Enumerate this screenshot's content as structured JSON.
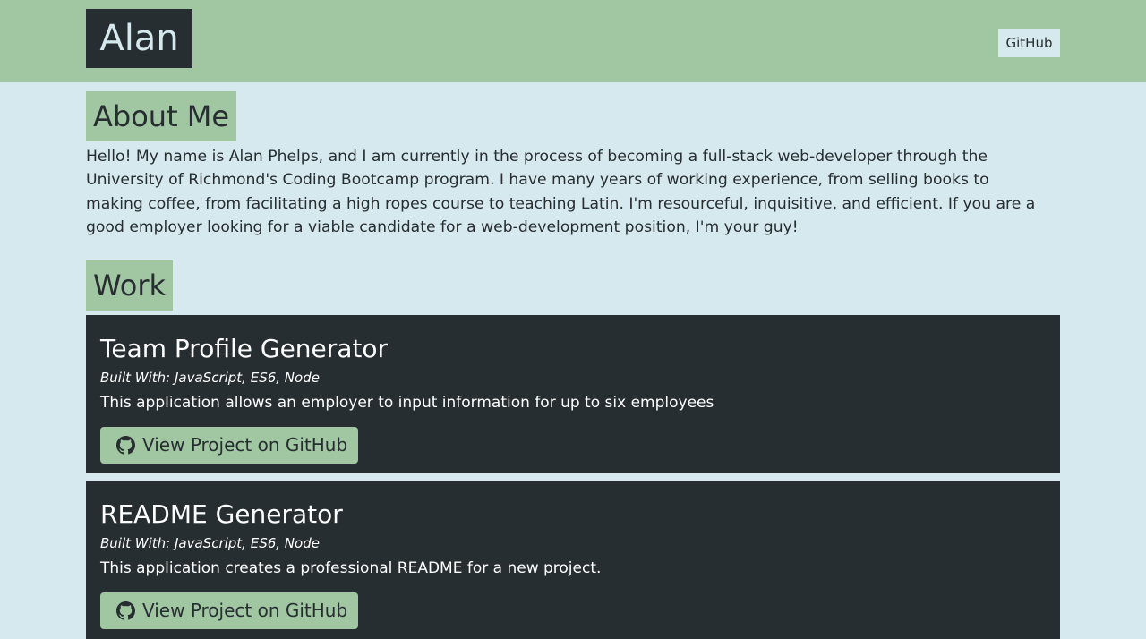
{
  "header": {
    "brand": "Alan",
    "nav_link": "GitHub"
  },
  "about": {
    "heading": "About Me",
    "text": "Hello! My name is Alan Phelps, and I am currently in the process of becoming a full-stack web-developer through the University of Richmond's Coding Bootcamp program. I have many years of working experience, from selling books to making coffee, from facilitating a high ropes course to teaching Latin. I'm resourceful, inquisitive, and efficient. If you are a good employer looking for a viable candidate for a web-development position, I'm your guy!"
  },
  "work": {
    "heading": "Work",
    "projects": [
      {
        "title": "Team Profile Generator",
        "built_with": "Built With: JavaScript, ES6, Node",
        "description": "This application allows an employer to input information for up to six employees",
        "button_label": "View Project on GitHub",
        "button_icon": "github-icon"
      },
      {
        "title": "README Generator",
        "built_with": "Built With: JavaScript, ES6, Node",
        "description": "This application creates a professional README for a new project.",
        "button_label": "View Project on GitHub",
        "button_icon": "github-icon"
      }
    ]
  },
  "colors": {
    "accent_green": "#a0c7a2",
    "dark": "#272e32",
    "page_background": "#d6e9ee"
  }
}
